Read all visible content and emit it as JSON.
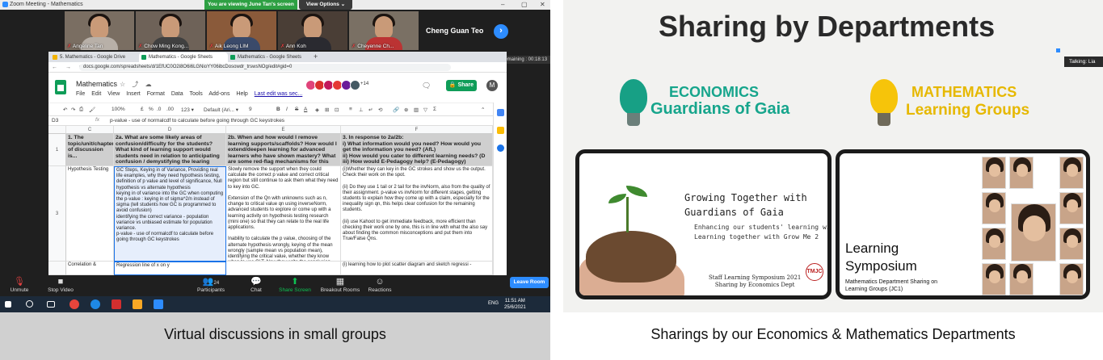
{
  "left": {
    "window_title": "Zoom Meeting - Mathematics",
    "viewing_banner": "You are viewing June Tan's screen",
    "view_options": "View Options ⌄",
    "participants": [
      {
        "name": "Angeline Tan"
      },
      {
        "name": "Chow Ming Kong..."
      },
      {
        "name": "Aik Leong LIM"
      },
      {
        "name": "Ann Koh"
      },
      {
        "name": "Cheyenne Ch..."
      }
    ],
    "featured_name": "Cheng Guan Teo",
    "remaining": "Remaining : 00:18:13",
    "tabs": [
      {
        "label": "5. Mathematics - Google Drive"
      },
      {
        "label": "Mathematics - Google Sheets"
      },
      {
        "label": "Mathematics - Google Sheets"
      }
    ],
    "url": "docs.google.com/spreadsheets/d/1EfUC0O2i8O6i6LGNioYY06ibcDosowdr_trswsNOg/edit#gid=0",
    "sheet": {
      "title": "Mathematics",
      "menus": [
        "File",
        "Edit",
        "View",
        "Insert",
        "Format",
        "Data",
        "Tools",
        "Add-ons",
        "Help"
      ],
      "last_edit": "Last edit was sec...",
      "avatar_count": "+14",
      "share_label": "Share",
      "user_initial": "M",
      "toolbar": {
        "zoom": "100%",
        "currency": "£",
        "percent": "%",
        "dec1": ".0",
        "dec2": ".00",
        "fmt": "123 ▾",
        "font": "Default (Ari... ▾",
        "size": "9",
        "bold": "B",
        "italic": "I",
        "strike": "S",
        "textcolor": "A"
      },
      "cell_ref": "D3",
      "fx": "fx",
      "formula_value": "p-value - use of normalcdf to calculate before going through GC keystrokes",
      "columns": [
        "C",
        "D",
        "E",
        "F"
      ],
      "rows": [
        "1",
        "3",
        ""
      ],
      "header_c": "1. The topic/unit/chapter of discussion is...",
      "header_d": "2a. What are some likely areas of confusion/difficulty for the students? What kind of learning support would students need in relation to anticipating confusion / demystifying the learing process?",
      "header_e": "2b. When and how would I remove learning supports/scaffolds? How would I extend/deepen learning for advanced learners who have shown mastery? What are some red-flag mechanisms for this",
      "header_f": "3. In response to 2a/2b:\ni) What information would you need? How would you get the information you need? (AfL)\nii) How would you cater to different learning needs? (D\niii) How would E-Pedagogy help? (E-Pedagogy)",
      "row3_c": "Hypothesis Testing",
      "row3_d": "GC Steps, Keying in of Variance, Providing real life examples, why they need hypothesis testing, definition of p value and level of significance, Null hypothesis vs alternate hypothesis\nkeying in of variance into the GC when computing the p-value : keying in of sigma^2/n instead of sigma (tell students how GC is programmed to avoid confusion)\nidentifying the correct variance - population variance vs unbiased estimate for population variance.\np-value - use of normalcdf to calculate before going through GC keystrokes",
      "row3_e": "Slowly remove the support when they could calculate the correct p value and correct critical region but still continue to ask them what they need to key into GC.\n\nExtension of the Qn with unknowns such as n, change to critical value qn using inverseNorm, advanced students to explore or come up with a learning activity on hypothesis testing research (mini one) so that they can relate to the real life applications.\n\nInability to calculate the p value, choosing of the alternate hypothesis wrongly, keying of the mean wrongly (sample mean vs population mean), identifying the critical value, whether they know when to use CLT. Now they write the conclusion.",
      "row3_f": "(i)Whether they can key in the GC strokes and show us the output. Check their work on the spot.\n\n(ii) Do they use 1 tail or 2 tail for the invNorm, also from the quality of their assignment. p-value vs invNorm for different stages, getting students to explain how they come up with a claim, especially for the inequality sign qn, this helps clear confusion for the remaining students.\n\n(iii) use Kahoot to get immediate feedback, more efficient than checking their work one by one, this is in line with what the also say about finding the common misconceptions and put them into True/False Qns.",
      "row4_c": "Correlation &",
      "row4_d": "Regression line of x on y",
      "row4_f": "(i) learning how to plot scatter diagram and sketch regressi -"
    },
    "controls": [
      {
        "icon": "🎤",
        "label": "Unmute"
      },
      {
        "icon": "▭",
        "label": "Stop Video"
      },
      {
        "icon": "👥",
        "label": "Participants",
        "count": "24"
      },
      {
        "icon": "💬",
        "label": "Chat"
      },
      {
        "icon": "⬆",
        "label": "Share Screen"
      },
      {
        "icon": "▦",
        "label": "Breakout Rooms"
      },
      {
        "icon": "☺",
        "label": "Reactions"
      }
    ],
    "leave_label": "Leave Room",
    "taskbar": {
      "lang": "ENG",
      "time": "11:51 AM",
      "date": "25/6/2021"
    },
    "caption": "Virtual discussions in small groups"
  },
  "right": {
    "title": "Sharing by Departments",
    "econ_heading": "ECONOMICS",
    "econ_sub": "Guardians of Gaia",
    "math_heading": "MATHEMATICS",
    "math_sub": "Learning Groups",
    "card1": {
      "title_line1": "Growing Together with",
      "title_line2": "Guardians of Gaia",
      "sub_line1": "Enhancing our students' learning with ICT",
      "sub_line2": "Learning together with Grow Me 2",
      "footer_line1": "Staff Learning Symposium 2021",
      "footer_line2": "Sharing by Economics Dept",
      "seal_text": "TMJC"
    },
    "card2": {
      "title_line1": "Learning",
      "title_line2": "Symposium",
      "sub_line1": "Mathematics Department Sharing on",
      "sub_line2": "Learning Groups (JC1)"
    },
    "talking": "Talking: Lia",
    "caption": "Sharings by our Economics & Mathematics Departments"
  },
  "colors": {
    "economics": "#16a58c",
    "mathematics": "#e6b800",
    "zoom_blue": "#2d8cff",
    "sheets_green": "#0f9d58"
  }
}
